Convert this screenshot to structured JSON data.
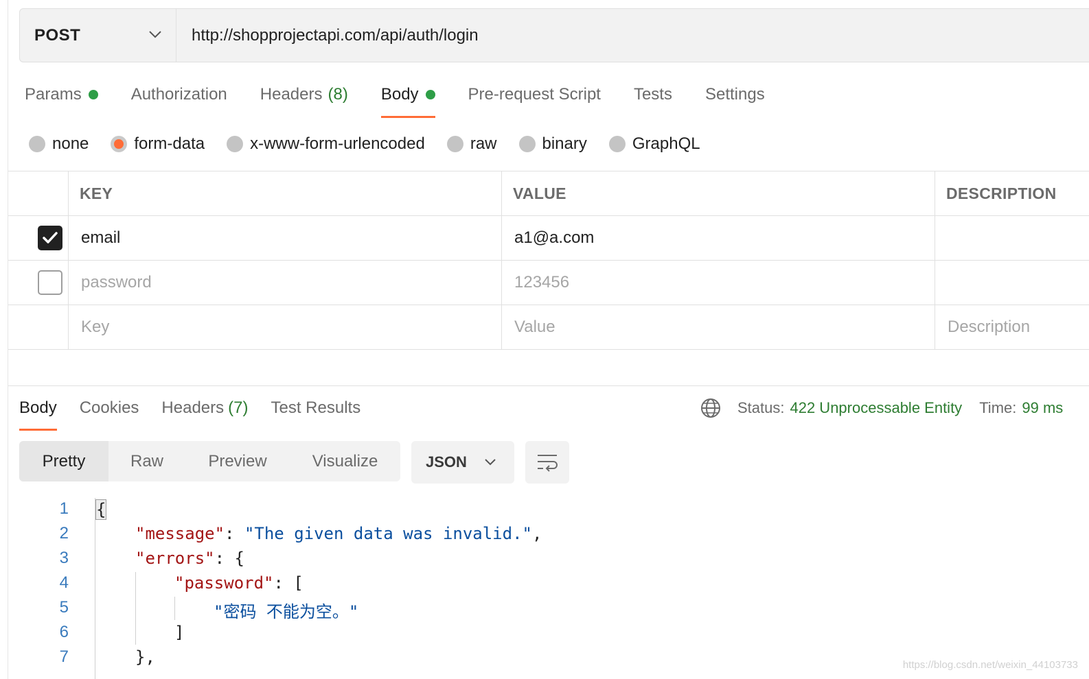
{
  "request": {
    "method": "POST",
    "url": "http://shopprojectapi.com/api/auth/login"
  },
  "request_tabs": [
    {
      "label": "Params",
      "has_dot": true
    },
    {
      "label": "Authorization"
    },
    {
      "label": "Headers",
      "count": "(8)"
    },
    {
      "label": "Body",
      "has_dot": true,
      "active": true
    },
    {
      "label": "Pre-request Script"
    },
    {
      "label": "Tests"
    },
    {
      "label": "Settings"
    }
  ],
  "body_types": [
    {
      "label": "none"
    },
    {
      "label": "form-data",
      "selected": true
    },
    {
      "label": "x-www-form-urlencoded"
    },
    {
      "label": "raw"
    },
    {
      "label": "binary"
    },
    {
      "label": "GraphQL"
    }
  ],
  "params_table": {
    "headers": {
      "key": "KEY",
      "value": "VALUE",
      "description": "DESCRIPTION"
    },
    "rows": [
      {
        "checked": true,
        "key": "email",
        "value": "a1@a.com"
      },
      {
        "checked": false,
        "key": "password",
        "value": "123456"
      }
    ],
    "placeholders": {
      "key": "Key",
      "value": "Value",
      "description": "Description"
    }
  },
  "response_tabs": [
    {
      "label": "Body",
      "active": true
    },
    {
      "label": "Cookies"
    },
    {
      "label": "Headers",
      "count": "(7)"
    },
    {
      "label": "Test Results"
    }
  ],
  "status": {
    "status_label": "Status:",
    "status_value": "422 Unprocessable Entity",
    "time_label": "Time:",
    "time_value": "99 ms"
  },
  "view_modes": [
    "Pretty",
    "Raw",
    "Preview",
    "Visualize"
  ],
  "format": "JSON",
  "code_lines": {
    "n1": "1",
    "n2": "2",
    "n3": "3",
    "n4": "4",
    "n5": "5",
    "n6": "6",
    "n7": "7",
    "l1_open": "{",
    "l2_key": "\"message\"",
    "l2_colon": ": ",
    "l2_val": "\"The given data was invalid.\"",
    "l2_comma": ",",
    "l3_key": "\"errors\"",
    "l3_rest": ": {",
    "l4_key": "\"password\"",
    "l4_rest": ": [",
    "l5_val": "\"密码 不能为空。\"",
    "l6": "]",
    "l7": "},"
  },
  "watermark": "https://blog.csdn.net/weixin_44103733",
  "colors": {
    "accent": "#ff6c37",
    "success": "#2e7d32",
    "json_key": "#a31515",
    "json_string": "#0b4f9e"
  }
}
